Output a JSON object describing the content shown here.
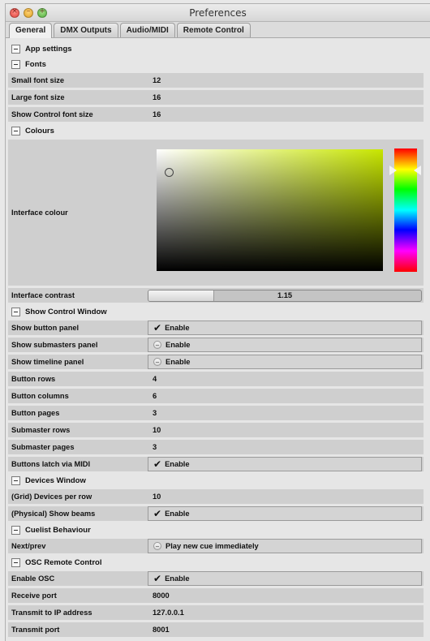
{
  "window": {
    "title": "Preferences",
    "close_glyph": "×",
    "minimize_glyph": "–",
    "zoom_glyph": "+"
  },
  "tabs": [
    "General",
    "DMX Outputs",
    "Audio/MIDI",
    "Remote Control"
  ],
  "app_settings": {
    "title": "App settings"
  },
  "fonts": {
    "title": "Fonts",
    "rows": [
      {
        "label": "Small font size",
        "value": "12"
      },
      {
        "label": "Large font size",
        "value": "16"
      },
      {
        "label": "Show Control font size",
        "value": "16"
      }
    ]
  },
  "colours": {
    "title": "Colours",
    "interface_colour_label": "Interface colour",
    "picker_hue_color": "#c8e600",
    "interface_contrast_label": "Interface contrast",
    "interface_contrast_value": "1.15",
    "interface_contrast_fill_fraction": 0.24
  },
  "show_control": {
    "title": "Show Control Window",
    "show_button_panel": {
      "label": "Show button panel",
      "value": "Enable",
      "checked": true
    },
    "show_submasters_panel": {
      "label": "Show submasters panel",
      "value": "Enable",
      "checked": false
    },
    "show_timeline_panel": {
      "label": "Show timeline panel",
      "value": "Enable",
      "checked": false
    },
    "button_rows": {
      "label": "Button rows",
      "value": "4"
    },
    "button_columns": {
      "label": "Button columns",
      "value": "6"
    },
    "button_pages": {
      "label": "Button pages",
      "value": "3"
    },
    "submaster_rows": {
      "label": "Submaster rows",
      "value": "10"
    },
    "submaster_pages": {
      "label": "Submaster pages",
      "value": "3"
    },
    "buttons_latch": {
      "label": "Buttons latch via MIDI",
      "value": "Enable",
      "checked": true
    }
  },
  "devices": {
    "title": "Devices Window",
    "devices_per_row": {
      "label": "(Grid) Devices per row",
      "value": "10"
    },
    "show_beams": {
      "label": "(Physical) Show beams",
      "value": "Enable",
      "checked": true
    }
  },
  "cuelist": {
    "title": "Cuelist Behaviour",
    "next_prev": {
      "label": "Next/prev",
      "value": "Play new cue immediately"
    }
  },
  "osc": {
    "title": "OSC Remote Control",
    "enable": {
      "label": "Enable OSC",
      "value": "Enable",
      "checked": true
    },
    "receive_port": {
      "label": "Receive port",
      "value": "8000"
    },
    "transmit_ip": {
      "label": "Transmit to IP address",
      "value": "127.0.0.1"
    },
    "transmit_port": {
      "label": "Transmit port",
      "value": "8001"
    }
  },
  "glyphs": {
    "check": "✔"
  }
}
